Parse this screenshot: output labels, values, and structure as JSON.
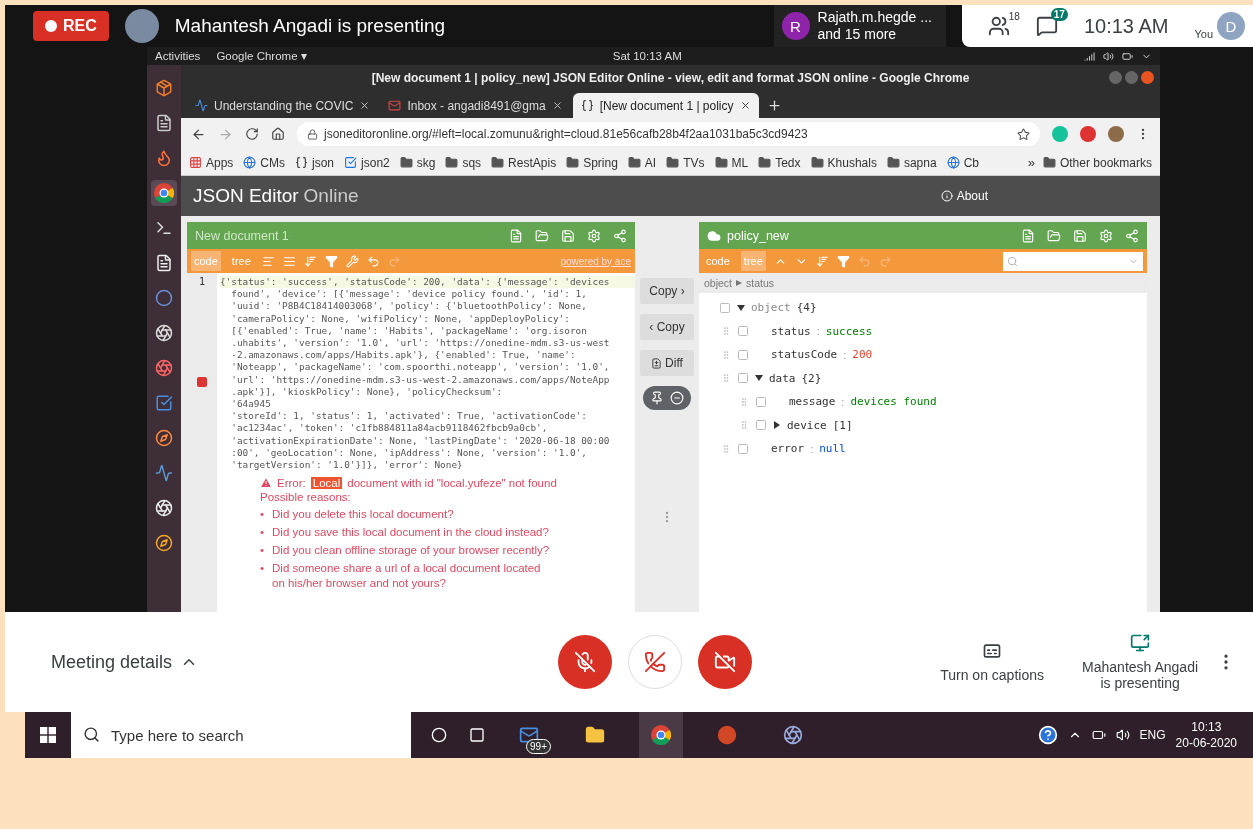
{
  "meet_top": {
    "rec": "REC",
    "presenter": "Mahantesh Angadi is presenting",
    "participants": {
      "initial": "R",
      "name": "Rajath.m.hegde ...",
      "more": "and 15 more"
    },
    "people_count": "18",
    "chat_count": "17",
    "time": "10:13 AM",
    "self": {
      "initial": "D",
      "label": "You"
    }
  },
  "desktop": {
    "activities": "Activities",
    "app_menu": "Google Chrome ▾",
    "clock": "Sat 10:13 AM"
  },
  "browser": {
    "title": "[New document 1 | policy_new]  JSON Editor Online - view, edit and format JSON online - Google Chrome",
    "tabs": [
      {
        "label": "Understanding the COVIC",
        "selected": false
      },
      {
        "label": "Inbox - angadi8491@gma",
        "selected": false
      },
      {
        "label": "[New document 1 | policy",
        "selected": true
      }
    ],
    "url": "jsoneditoronline.org/#left=local.zomunu&right=cloud.81e56cafb28b4f2aa1031ba5c3cd9423",
    "bookmarks": [
      {
        "label": "Apps",
        "kind": "apps"
      },
      {
        "label": "CMs",
        "kind": "site"
      },
      {
        "label": "json",
        "kind": "code"
      },
      {
        "label": "json2",
        "kind": "check"
      },
      {
        "label": "skg",
        "kind": "folder"
      },
      {
        "label": "sqs",
        "kind": "folder"
      },
      {
        "label": "RestApis",
        "kind": "folder"
      },
      {
        "label": "Spring",
        "kind": "folder"
      },
      {
        "label": "AI",
        "kind": "folder"
      },
      {
        "label": "TVs",
        "kind": "folder"
      },
      {
        "label": "ML",
        "kind": "folder"
      },
      {
        "label": "Tedx",
        "kind": "folder"
      },
      {
        "label": "Khushals",
        "kind": "folder"
      },
      {
        "label": "sapna",
        "kind": "folder"
      },
      {
        "label": "Cb",
        "kind": "site"
      }
    ],
    "more": "»",
    "other_bookmarks": "Other bookmarks"
  },
  "app": {
    "logo": "JSON Editor",
    "logo_suffix": "Online",
    "about": "About"
  },
  "left_panel": {
    "title": "New document 1",
    "modes": [
      {
        "label": "code",
        "selected": true
      },
      {
        "label": "tree",
        "selected": false
      }
    ],
    "powered_by": "powered by ace",
    "line_number": "1",
    "code_lines": [
      "{'status': 'success', 'statusCode': 200, 'data': {'message': 'devices",
      "  found', 'device': [{'message': 'device policy found.', 'id': 1,",
      "  'uuid': 'P8B4C18414003068', 'policy': {'bluetoothPolicy': None,",
      "  'cameraPolicy': None, 'wifiPolicy': None, 'appDeployPolicy':",
      "  [{'enabled': True, 'name': 'Habits', 'packageName': 'org.isoron",
      "  .uhabits', 'version': '1.0', 'url': 'https://onedine-mdm.s3-us-west",
      "  -2.amazonaws.com/apps/Habits.apk'}, {'enabled': True, 'name':",
      "  'Noteapp', 'packageName': 'com.spoorthi.noteapp', 'version': '1.0',",
      "  'url': 'https://onedine-mdm.s3-us-west-2.amazonaws.com/apps/NoteApp",
      "  .apk'}], 'kioskPolicy': None}, 'policyChecksum':",
      "  '64a945",
      "  'storeId': 1, 'status': 1, 'activated': True, 'activationCode':",
      "  'ac1234ac', 'token': 'c1fb884811a84acb9118462fbcb9a0cb',",
      "  'activationExpirationDate': None, 'lastPingDate': '2020-06-18 00:00",
      "  :00', 'geoLocation': None, 'ipAddress': None, 'version': '1.0',",
      "  'targetVersion': '1.0'}]}, 'error': None}"
    ],
    "error": {
      "prefix": "Error:",
      "highlight": "Local",
      "message": "document with id \"local.yufeze\" not found",
      "reasons_title": "Possible reasons:",
      "bullet": "•",
      "reasons": [
        "Did you delete this local document?",
        "Did you save this local document in the cloud instead?",
        "Did you clean offline storage of your browser recently?",
        "Did someone share a url of a local document located on his/her browser and not yours?"
      ]
    }
  },
  "copy_buttons": [
    "Copy ›",
    "‹ Copy",
    "Diff"
  ],
  "right_panel": {
    "title": "policy_new",
    "modes": [
      {
        "label": "code",
        "selected": false
      },
      {
        "label": "tree",
        "selected": true
      }
    ],
    "breadcrumb": [
      "object",
      "status"
    ],
    "separator": ":",
    "tree": [
      {
        "key": "object",
        "info": "{4}",
        "expanded": true,
        "children": [
          {
            "key": "status",
            "value": "success",
            "kind": "string"
          },
          {
            "key": "statusCode",
            "value": "200",
            "kind": "number"
          },
          {
            "key": "data",
            "info": "{2}",
            "expanded": true,
            "children": [
              {
                "key": "message",
                "value": "devices found",
                "kind": "string"
              },
              {
                "key": "device",
                "info": "[1]",
                "expanded": false
              }
            ]
          },
          {
            "key": "error",
            "value": "null",
            "kind": "null"
          }
        ]
      }
    ]
  },
  "meet_bottom": {
    "details": "Meeting details",
    "captions": "Turn on captions",
    "presenting": "Mahantesh Angadi is presenting"
  },
  "taskbar": {
    "search_placeholder": "Type here to search",
    "mail_badge": "99+",
    "language": "ENG",
    "time": "10:13",
    "date": "20-06-2020"
  }
}
